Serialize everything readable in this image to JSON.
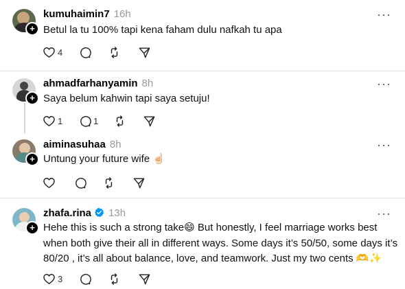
{
  "posts": [
    {
      "username": "kumuhaimin7",
      "time": "16h",
      "text": "Betul la tu 100% tapi kena faham dulu nafkah tu apa",
      "likes": "4",
      "replies": "",
      "verified": false
    },
    {
      "username": "ahmadfarhanyamin",
      "time": "8h",
      "text": "Saya belum kahwin tapi saya setuju!",
      "likes": "1",
      "replies": "1",
      "verified": false
    },
    {
      "username": "aiminasuhaa",
      "time": "8h",
      "text": "Untung your future wife ☝🏻",
      "likes": "",
      "replies": "",
      "verified": false
    },
    {
      "username": "zhafa.rina",
      "time": "13h",
      "text_lines": [
        "Hehe this is such a strong take😄 But honestly, I feel marriage works best",
        "when both give their all in different ways. Some days it’s 50/50, some days it’s",
        "80/20 , it’s all about balance, love, and teamwork. Just my two cents 🫶✨"
      ],
      "likes": "3",
      "replies": "",
      "verified": true
    }
  ],
  "icons": {
    "like": "heart-icon",
    "reply": "comment-icon",
    "repost": "repost-icon",
    "share": "send-icon",
    "more": "more-icon"
  },
  "colors": {
    "verified": "#0095f6",
    "muted": "#999999"
  }
}
